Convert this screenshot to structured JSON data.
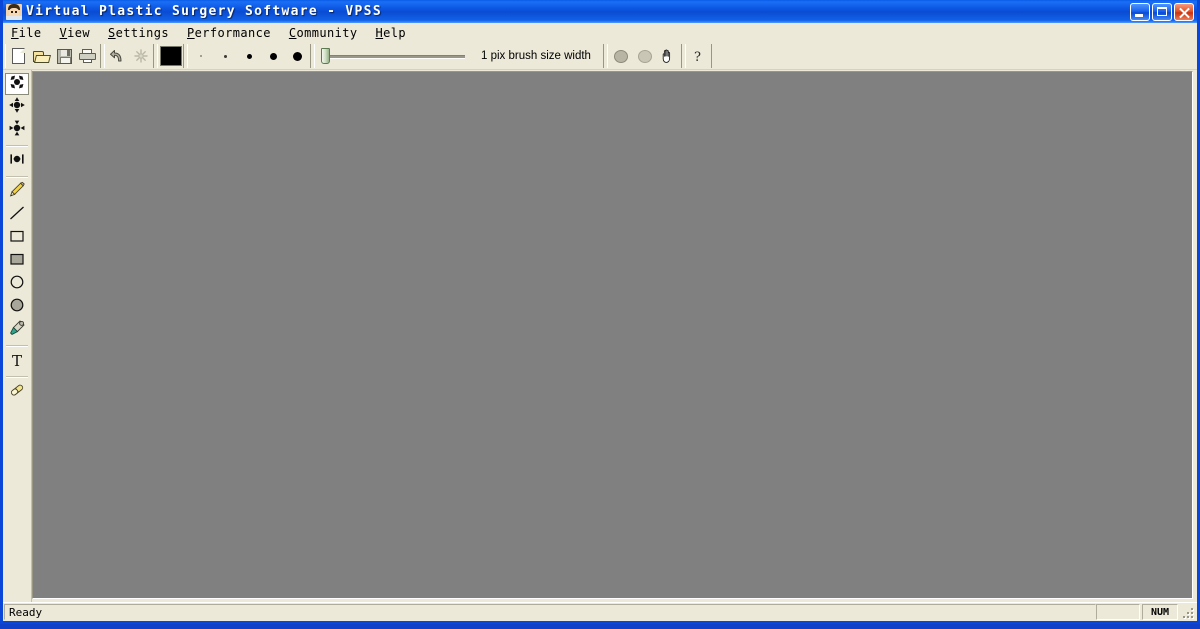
{
  "window": {
    "title": "Virtual Plastic Surgery Software - VPSS",
    "icon": "face-avatar-icon",
    "buttons": {
      "minimize": "minimize-button",
      "maximize": "maximize-button",
      "close": "close-button"
    }
  },
  "menu": {
    "items": [
      {
        "label": "File",
        "mnemonic": "F",
        "rest": "ile"
      },
      {
        "label": "View",
        "mnemonic": "V",
        "rest": "iew"
      },
      {
        "label": "Settings",
        "mnemonic": "S",
        "rest": "ettings"
      },
      {
        "label": "Performance",
        "mnemonic": "P",
        "rest": "erformance"
      },
      {
        "label": "Community",
        "mnemonic": "C",
        "rest": "ommunity"
      },
      {
        "label": "Help",
        "mnemonic": "H",
        "rest": "elp"
      }
    ]
  },
  "toolbar": {
    "file_buttons": [
      {
        "name": "new-document-button",
        "icon": "new-file-icon",
        "tooltip": "New"
      },
      {
        "name": "open-file-button",
        "icon": "open-folder-icon",
        "tooltip": "Open"
      },
      {
        "name": "save-file-button",
        "icon": "floppy-disk-icon",
        "tooltip": "Save"
      },
      {
        "name": "print-button",
        "icon": "printer-icon",
        "tooltip": "Print"
      }
    ],
    "edit_buttons": [
      {
        "name": "undo-button",
        "icon": "undo-arrow-icon",
        "tooltip": "Undo",
        "enabled": true
      },
      {
        "name": "refresh-button",
        "icon": "sparkle-icon",
        "tooltip": "Redo",
        "enabled": false
      }
    ],
    "color_swatch": {
      "name": "foreground-color-swatch",
      "color": "#000000",
      "tooltip": "Color"
    },
    "brush_sizes": [
      {
        "label": "1",
        "px": 1
      },
      {
        "label": "2",
        "px": 2
      },
      {
        "label": "4",
        "px": 4
      },
      {
        "label": "6",
        "px": 6
      },
      {
        "label": "8",
        "px": 8
      }
    ],
    "slider": {
      "name": "brush-size-slider",
      "value": 1,
      "min": 1,
      "max": 100
    },
    "brush_label": "1 pix brush size width",
    "shape_buttons": [
      {
        "name": "soft-brush-button",
        "icon": "filled-circle-icon"
      },
      {
        "name": "airbrush-button",
        "icon": "soft-circle-icon"
      },
      {
        "name": "pan-hand-button",
        "icon": "hand-icon"
      }
    ],
    "help_button": {
      "name": "help-about-button",
      "icon": "question-mark-icon",
      "label": "?"
    }
  },
  "palette": {
    "groups": [
      {
        "tools": [
          {
            "name": "tool-warp-expand",
            "icon": "warp-expand-icon",
            "selected": true
          },
          {
            "name": "tool-warp-move",
            "icon": "warp-move-icon",
            "selected": false
          },
          {
            "name": "tool-warp-pinch",
            "icon": "warp-pinch-icon",
            "selected": false
          }
        ]
      },
      {
        "tools": [
          {
            "name": "tool-warp-bracket",
            "icon": "warp-bracket-icon",
            "selected": false
          }
        ]
      },
      {
        "tools": [
          {
            "name": "tool-pencil",
            "icon": "pencil-icon",
            "selected": false
          },
          {
            "name": "tool-line",
            "icon": "line-icon",
            "selected": false
          },
          {
            "name": "tool-rectangle",
            "icon": "rectangle-outline-icon",
            "selected": false
          },
          {
            "name": "tool-filled-rectangle",
            "icon": "rectangle-filled-icon",
            "selected": false
          },
          {
            "name": "tool-ellipse",
            "icon": "ellipse-outline-icon",
            "selected": false
          },
          {
            "name": "tool-filled-ellipse",
            "icon": "ellipse-filled-icon",
            "selected": false
          },
          {
            "name": "tool-eyedropper",
            "icon": "eyedropper-icon",
            "selected": false
          }
        ]
      },
      {
        "tools": [
          {
            "name": "tool-text",
            "icon": "text-t-icon",
            "label": "T",
            "selected": false
          }
        ]
      },
      {
        "tools": [
          {
            "name": "tool-eraser",
            "icon": "eraser-icon",
            "selected": false
          }
        ]
      }
    ]
  },
  "canvas": {
    "name": "image-canvas",
    "background_color": "#808080"
  },
  "statusbar": {
    "message": "Ready",
    "num_indicator": "NUM"
  },
  "colors": {
    "title_bar_blue": "#0a4cd2",
    "window_face": "#ece9d8",
    "canvas_grey": "#808080",
    "desktop": "#1040c8"
  }
}
